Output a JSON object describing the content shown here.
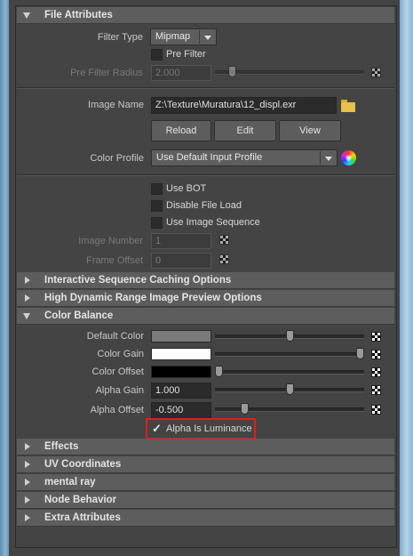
{
  "file_attributes": {
    "header": "File Attributes",
    "filter_type_label": "Filter Type",
    "filter_type_value": "Mipmap",
    "pre_filter_label": "Pre Filter",
    "pre_filter_radius_label": "Pre Filter Radius",
    "pre_filter_radius_value": "2.000",
    "image_name_label": "Image Name",
    "image_name_value": "Z:\\Texture\\Muratura\\12_displ.exr",
    "reload_label": "Reload",
    "edit_label": "Edit",
    "view_label": "View",
    "color_profile_label": "Color Profile",
    "color_profile_value": "Use Default Input Profile",
    "use_bot_label": "Use BOT",
    "disable_file_load_label": "Disable File Load",
    "use_image_sequence_label": "Use Image Sequence",
    "image_number_label": "Image Number",
    "image_number_value": "1",
    "frame_offset_label": "Frame Offset",
    "frame_offset_value": "0"
  },
  "collapsed_sections_top": [
    "Interactive Sequence Caching Options",
    "High Dynamic Range Image Preview Options"
  ],
  "color_balance": {
    "header": "Color Balance",
    "default_color_label": "Default Color",
    "default_color_hex": "#7a7a7a",
    "default_color_slider": 0.5,
    "color_gain_label": "Color Gain",
    "color_gain_hex": "#ffffff",
    "color_gain_slider": 1.0,
    "color_offset_label": "Color Offset",
    "color_offset_hex": "#000000",
    "color_offset_slider": 0.0,
    "alpha_gain_label": "Alpha Gain",
    "alpha_gain_value": "1.000",
    "alpha_gain_slider": 0.5,
    "alpha_offset_label": "Alpha Offset",
    "alpha_offset_value": "-0.500",
    "alpha_offset_slider": 0.18,
    "alpha_is_luminance_label": "Alpha Is Luminance",
    "alpha_is_luminance_checked": true
  },
  "collapsed_sections_bottom": [
    "Effects",
    "UV Coordinates",
    "mental ray",
    "Node Behavior",
    "Extra Attributes"
  ],
  "colors": {
    "highlight": "#e01d1d"
  }
}
